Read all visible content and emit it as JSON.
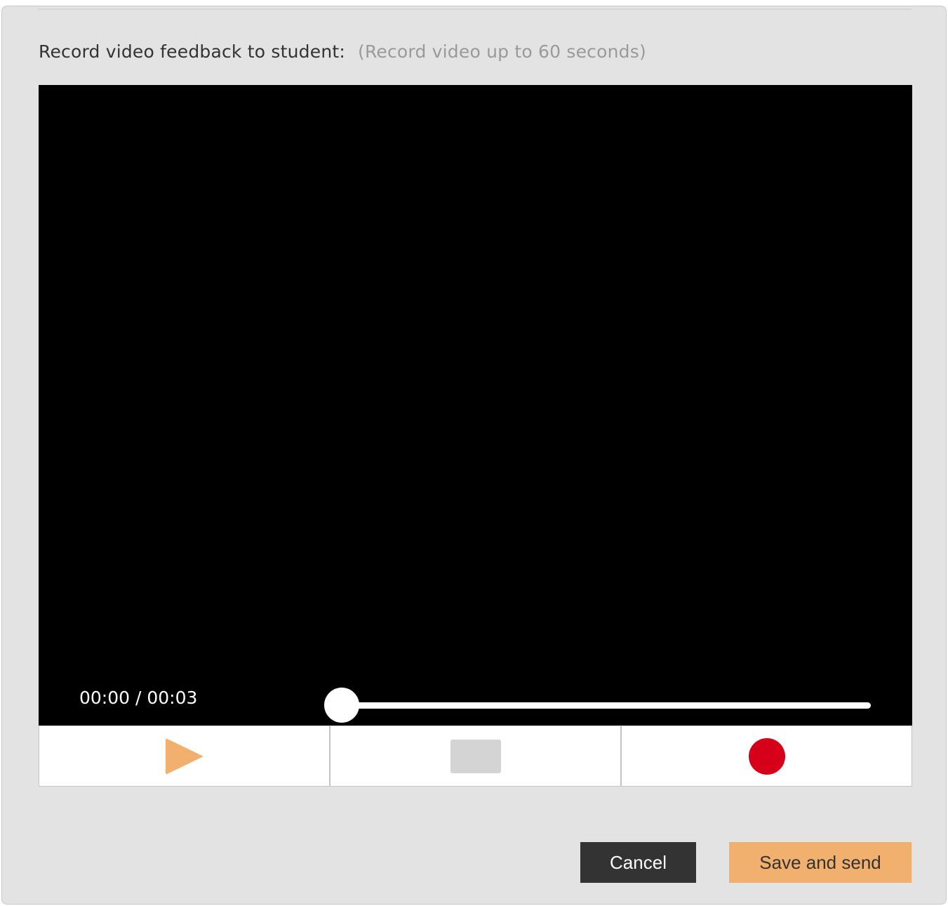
{
  "header": {
    "label": "Record video feedback to student:",
    "hint": "(Record video up to 60 seconds)"
  },
  "player": {
    "time_display": "00:00 / 00:03",
    "progress_fraction": 0.0
  },
  "controls": {
    "play_icon": "play-icon",
    "stop_icon": "stop-icon",
    "record_icon": "record-icon"
  },
  "actions": {
    "cancel_label": "Cancel",
    "save_label": "Save and send"
  },
  "colors": {
    "accent": "#f2b06f",
    "record": "#d6001a",
    "dark_button": "#333333",
    "panel_background": "#e3e3e3"
  }
}
